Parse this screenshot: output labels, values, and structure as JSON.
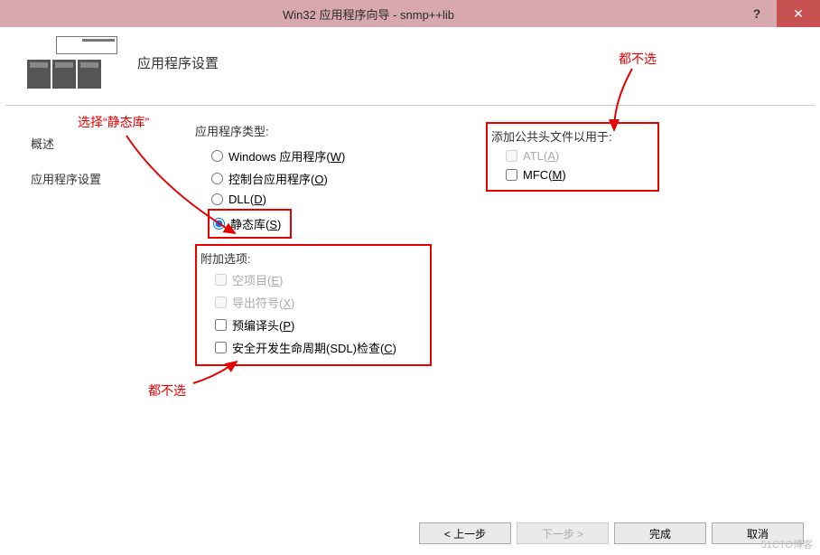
{
  "titlebar": {
    "title": "Win32 应用程序向导 - snmp++lib"
  },
  "header": {
    "section_title": "应用程序设置"
  },
  "sidebar": {
    "items": [
      {
        "label": "概述"
      },
      {
        "label": "应用程序设置"
      }
    ]
  },
  "app_type": {
    "label": "应用程序类型:",
    "options": [
      {
        "text": "Windows 应用程序(",
        "mn": "W",
        "suffix": ")"
      },
      {
        "text": "控制台应用程序(",
        "mn": "O",
        "suffix": ")"
      },
      {
        "text": "DLL(",
        "mn": "D",
        "suffix": ")"
      },
      {
        "text": "静态库(",
        "mn": "S",
        "suffix": ")"
      }
    ],
    "selected": 3
  },
  "add_opts": {
    "label": "附加选项:",
    "options": [
      {
        "text": "空项目(",
        "mn": "E",
        "suffix": ")",
        "disabled": true,
        "checked": false
      },
      {
        "text": "导出符号(",
        "mn": "X",
        "suffix": ")",
        "disabled": true,
        "checked": false
      },
      {
        "text": "预编译头(",
        "mn": "P",
        "suffix": ")",
        "disabled": false,
        "checked": false
      },
      {
        "text": "安全开发生命周期(SDL)检查(",
        "mn": "C",
        "suffix": ")",
        "disabled": false,
        "checked": false
      }
    ]
  },
  "header_files": {
    "label": "添加公共头文件以用于:",
    "options": [
      {
        "text": "ATL(",
        "mn": "A",
        "suffix": ")",
        "disabled": true,
        "checked": false
      },
      {
        "text": "MFC(",
        "mn": "M",
        "suffix": ")",
        "disabled": false,
        "checked": false
      }
    ]
  },
  "footer": {
    "back": "< 上一步",
    "next": "下一步 >",
    "finish": "完成",
    "cancel": "取消"
  },
  "annotations": {
    "select_static": "选择“静态库”",
    "none1": "都不选",
    "none2": "都不选"
  },
  "watermark": "51CTO博客"
}
